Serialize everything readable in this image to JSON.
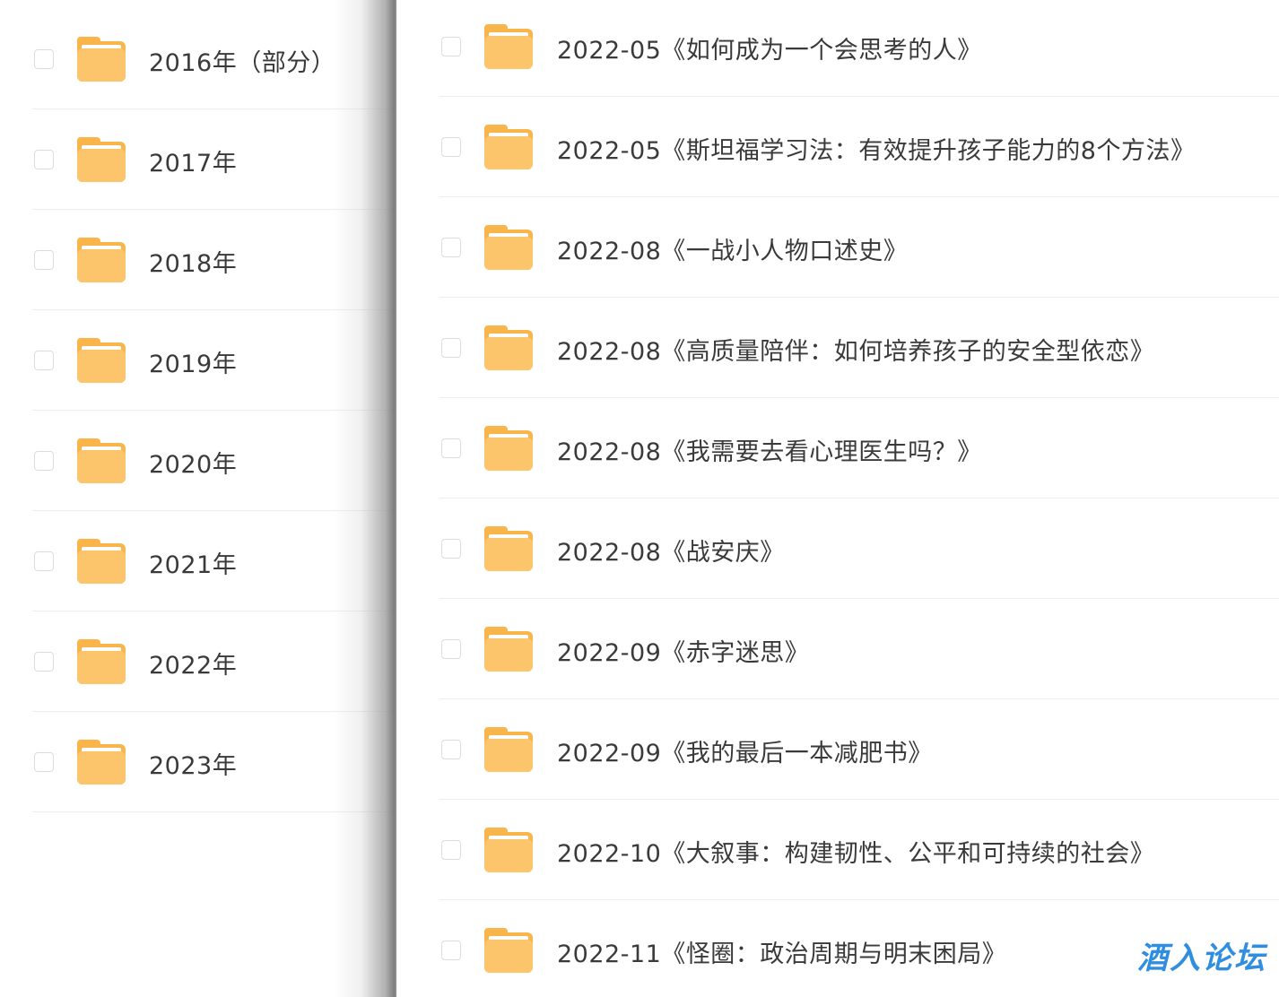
{
  "left_list": {
    "items": [
      {
        "label": "2016年（部分）"
      },
      {
        "label": "2017年"
      },
      {
        "label": "2018年"
      },
      {
        "label": "2019年"
      },
      {
        "label": "2020年"
      },
      {
        "label": "2021年"
      },
      {
        "label": "2022年"
      },
      {
        "label": "2023年"
      }
    ]
  },
  "right_list": {
    "items": [
      {
        "label": "2022-05《如何成为一个会思考的人》"
      },
      {
        "label": "2022-05《斯坦福学习法：有效提升孩子能力的8个方法》"
      },
      {
        "label": "2022-08《一战小人物口述史》"
      },
      {
        "label": "2022-08《高质量陪伴：如何培养孩子的安全型依恋》"
      },
      {
        "label": "2022-08《我需要去看心理医生吗？》"
      },
      {
        "label": "2022-08《战安庆》"
      },
      {
        "label": "2022-09《赤字迷思》"
      },
      {
        "label": "2022-09《我的最后一本减肥书》"
      },
      {
        "label": "2022-10《大叙事：构建韧性、公平和可持续的社会》"
      },
      {
        "label": "2022-11《怪圈：政治周期与明末困局》"
      }
    ]
  },
  "icons": {
    "folder": "folder-icon",
    "checkbox": "checkbox-icon"
  },
  "colors": {
    "folder_body": "#fcc56b",
    "folder_tab": "#f9b44a",
    "folder_paper": "#ffffff",
    "watermark": "#2f8ee0"
  },
  "watermark": {
    "text": "酒入论坛"
  }
}
